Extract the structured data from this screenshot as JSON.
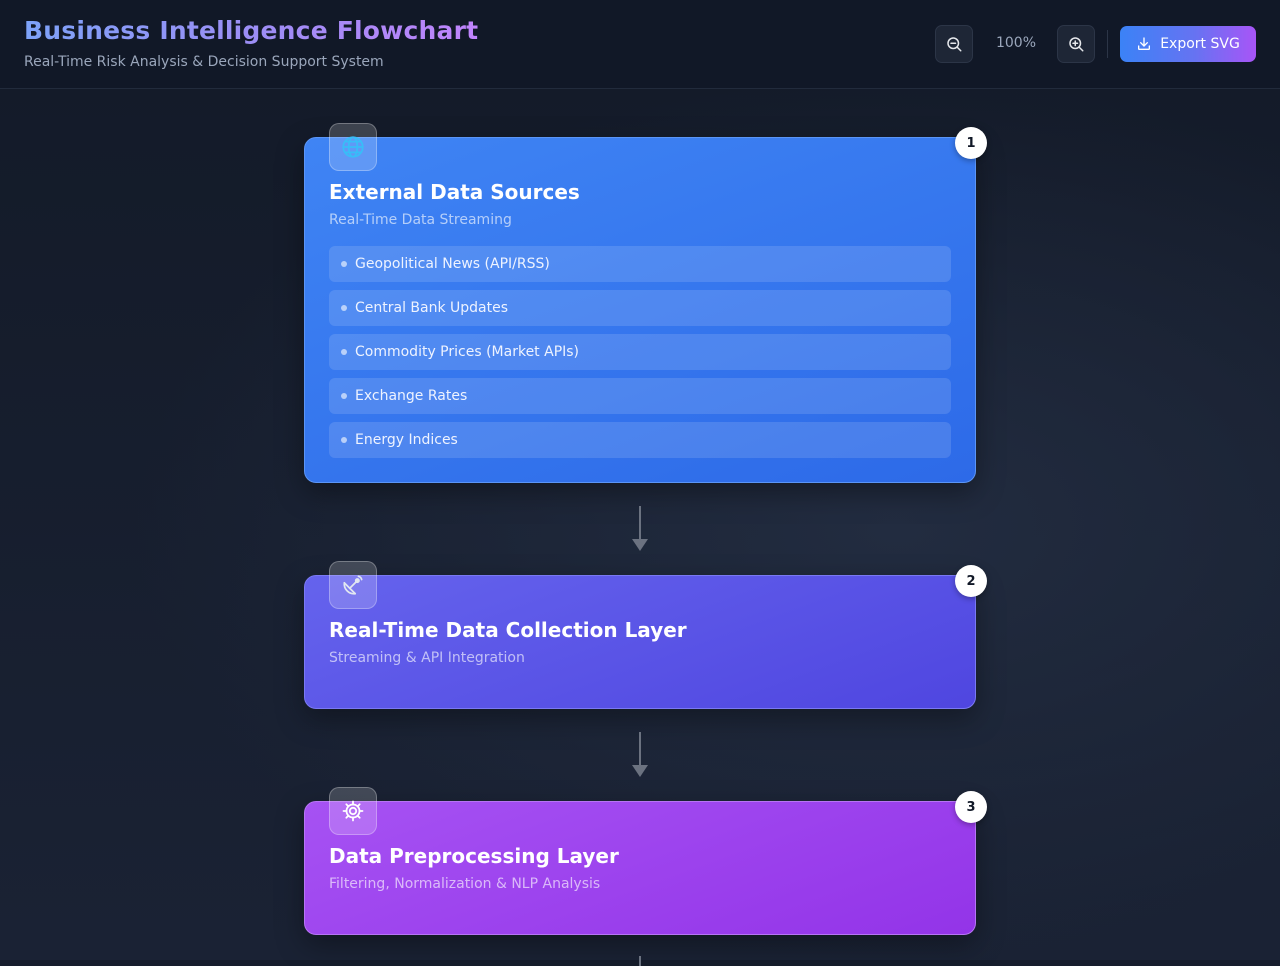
{
  "header": {
    "title": "Business Intelligence Flowchart",
    "subtitle": "Real-Time Risk Analysis & Decision Support System"
  },
  "toolbar": {
    "zoom_out_icon": "zoom-out-icon",
    "zoom_level": "100%",
    "zoom_in_icon": "zoom-in-icon",
    "export_icon": "download-icon",
    "export_label": "Export SVG"
  },
  "flow": {
    "steps": [
      {
        "number": "1",
        "icon": "globe-icon",
        "title": "External Data Sources",
        "subtitle": "Real-Time Data Streaming",
        "items": [
          "Geopolitical News (API/RSS)",
          "Central Bank Updates",
          "Commodity Prices (Market APIs)",
          "Exchange Rates",
          "Energy Indices"
        ]
      },
      {
        "number": "2",
        "icon": "satellite-dish-icon",
        "title": "Real-Time Data Collection Layer",
        "subtitle": "Streaming & API Integration"
      },
      {
        "number": "3",
        "icon": "gear-icon",
        "title": "Data Preprocessing Layer",
        "subtitle": "Filtering, Normalization & NLP Analysis"
      }
    ]
  },
  "colors": {
    "step1": "#3b82f6",
    "step2": "#5b5bea",
    "step3": "#a045f0",
    "connector": "#6b7280"
  }
}
